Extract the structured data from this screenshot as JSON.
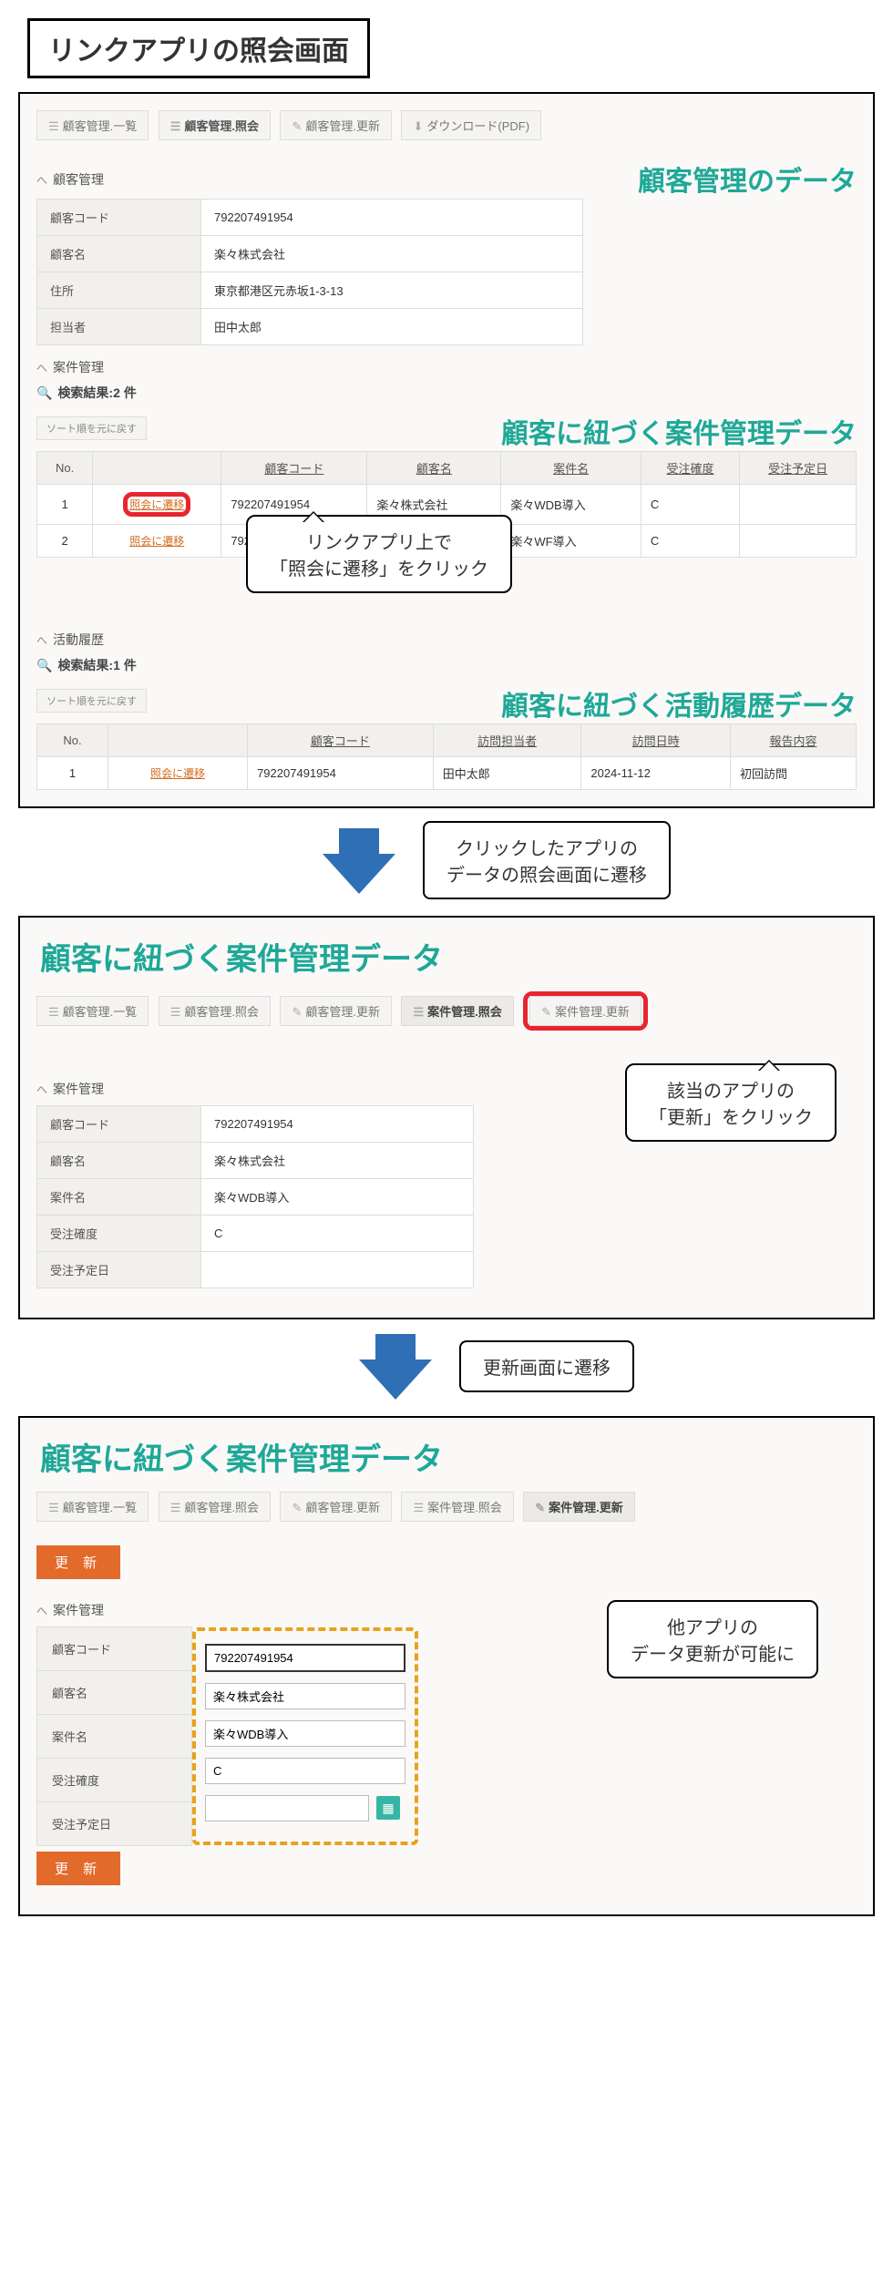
{
  "title": "リンクアプリの照会画面",
  "panel1": {
    "toolbar": [
      "顧客管理.一覧",
      "顧客管理.照会",
      "顧客管理.更新",
      "ダウンロード(PDF)"
    ],
    "overlay1": "顧客管理のデータ",
    "section_customer": "顧客管理",
    "customer_fields": {
      "f1": {
        "label": "顧客コード",
        "value": "792207491954"
      },
      "f2": {
        "label": "顧客名",
        "value": "楽々株式会社"
      },
      "f3": {
        "label": "住所",
        "value": "東京都港区元赤坂1-3-13"
      },
      "f4": {
        "label": "担当者",
        "value": "田中太郎"
      }
    },
    "section_anken": "案件管理",
    "search1": "検索結果:2 件",
    "sort": "ソート順を元に戻す",
    "overlay2": "顧客に紐づく案件管理データ",
    "grid1_headers": [
      "No.",
      "",
      "顧客コード",
      "顧客名",
      "案件名",
      "受注確度",
      "受注予定日"
    ],
    "grid1_rows": [
      {
        "no": "1",
        "link": "照会に遷移",
        "code": "792207491954",
        "name": "楽々株式会社",
        "anken": "楽々WDB導入",
        "kakudo": "C",
        "yotei": ""
      },
      {
        "no": "2",
        "link": "照会に遷移",
        "code": "792",
        "name": "楽々株式会社",
        "anken": "楽々WF導入",
        "kakudo": "C",
        "yotei": ""
      }
    ],
    "speech1a": "リンクアプリ上で",
    "speech1b": "「照会に遷移」をクリック",
    "section_activity": "活動履歴",
    "search2": "検索結果:1 件",
    "overlay3": "顧客に紐づく活動履歴データ",
    "grid2_headers": [
      "No.",
      "",
      "顧客コード",
      "訪問担当者",
      "訪問日時",
      "報告内容"
    ],
    "grid2_row": {
      "no": "1",
      "link": "照会に遷移",
      "code": "792207491954",
      "tanto": "田中太郎",
      "date": "2024-11-12",
      "houkoku": "初回訪問"
    }
  },
  "arrow1_a": "クリックしたアプリの",
  "arrow1_b": "データの照会画面に遷移",
  "panel2": {
    "title": "顧客に紐づく案件管理データ",
    "toolbar": [
      "顧客管理.一覧",
      "顧客管理.照会",
      "顧客管理.更新",
      "案件管理.照会",
      "案件管理.更新"
    ],
    "section": "案件管理",
    "fields": {
      "f1": {
        "label": "顧客コード",
        "value": "792207491954"
      },
      "f2": {
        "label": "顧客名",
        "value": "楽々株式会社"
      },
      "f3": {
        "label": "案件名",
        "value": "楽々WDB導入"
      },
      "f4": {
        "label": "受注確度",
        "value": "C"
      },
      "f5": {
        "label": "受注予定日",
        "value": ""
      }
    },
    "speech_a": "該当のアプリの",
    "speech_b": "「更新」をクリック"
  },
  "arrow2": "更新画面に遷移",
  "panel3": {
    "title": "顧客に紐づく案件管理データ",
    "toolbar": [
      "顧客管理.一覧",
      "顧客管理.照会",
      "顧客管理.更新",
      "案件管理.照会",
      "案件管理.更新"
    ],
    "update": "更 新",
    "section": "案件管理",
    "speech_a": "他アプリの",
    "speech_b": "データ更新が可能に",
    "fields": {
      "f1": {
        "label": "顧客コード",
        "value": "792207491954"
      },
      "f2": {
        "label": "顧客名",
        "value": "楽々株式会社"
      },
      "f3": {
        "label": "案件名",
        "value": "楽々WDB導入"
      },
      "f4": {
        "label": "受注確度",
        "value": "C"
      },
      "f5": {
        "label": "受注予定日",
        "value": ""
      }
    }
  }
}
